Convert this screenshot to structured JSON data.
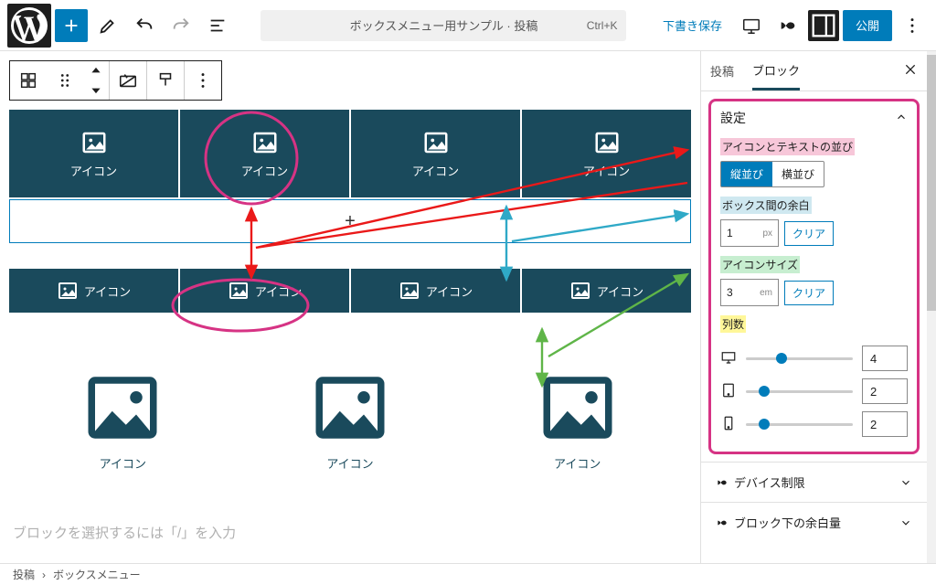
{
  "topbar": {
    "title": "ボックスメニュー用サンプル · 投稿",
    "shortcut": "Ctrl+K",
    "save_draft": "下書き保存",
    "publish": "公開"
  },
  "canvas": {
    "cell_label": "アイコン",
    "rows": [
      {
        "variant": "normal",
        "cols": 4
      },
      {
        "variant": "small",
        "cols": 4
      },
      {
        "variant": "large",
        "cols": 3
      }
    ],
    "placeholder": "ブロックを選択するには「/」を入力"
  },
  "sidebar": {
    "tabs": {
      "post": "投稿",
      "block": "ブロック"
    },
    "settings_title": "設定",
    "alignment": {
      "label": "アイコンとテキストの並び",
      "vertical": "縦並び",
      "horizontal": "横並び"
    },
    "gap": {
      "label": "ボックス間の余白",
      "value": "1",
      "unit": "px",
      "clear": "クリア"
    },
    "iconsize": {
      "label": "アイコンサイズ",
      "value": "3",
      "unit": "em",
      "clear": "クリア"
    },
    "cols": {
      "label": "列数",
      "rows": [
        {
          "device": "desktop",
          "value": "4",
          "pct": 28
        },
        {
          "device": "tablet",
          "value": "2",
          "pct": 12
        },
        {
          "device": "mobile",
          "value": "2",
          "pct": 12
        }
      ]
    },
    "accordions": {
      "device": "デバイス制限",
      "margin": "ブロック下の余白量"
    }
  },
  "breadcrumb": {
    "post": "投稿",
    "sep": "›",
    "block": "ボックスメニュー"
  }
}
